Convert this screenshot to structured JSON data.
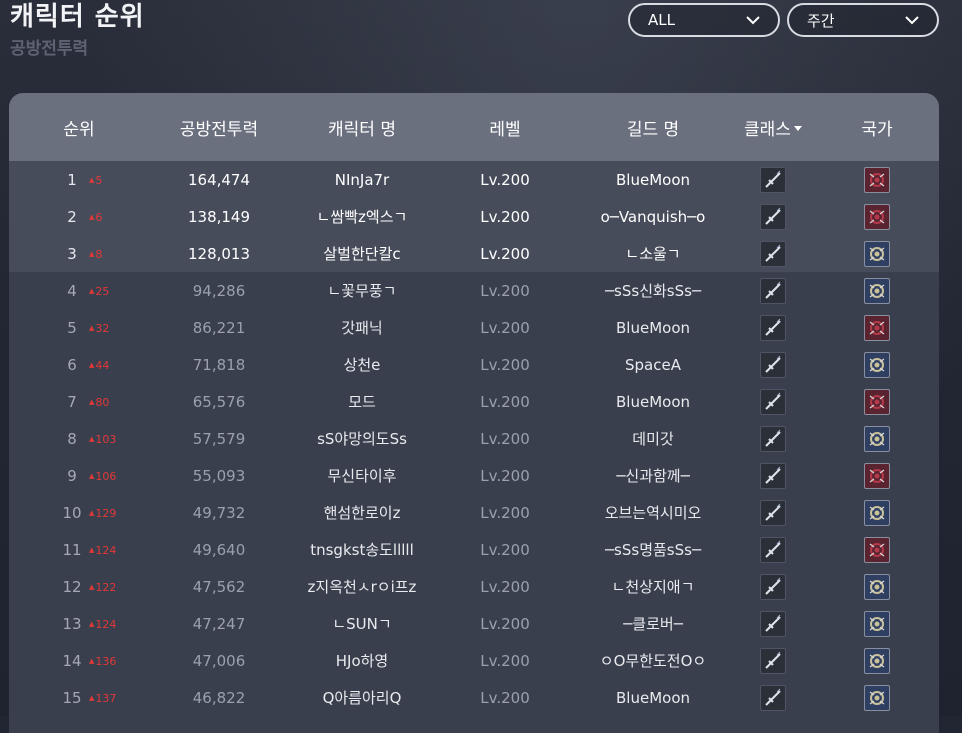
{
  "header": {
    "title": "캐릭터 순위",
    "subtitle": "공방전투력"
  },
  "filters": {
    "region": "ALL",
    "period": "주간"
  },
  "table": {
    "columns": [
      "순위",
      "공방전투력",
      "캐릭터 명",
      "레벨",
      "길드 명",
      "클래스",
      "국가"
    ],
    "rows": [
      {
        "rank": "1",
        "change": "5",
        "power": "164,474",
        "name": "NInJa7r",
        "level": "Lv.200",
        "guild": "BlueMoon",
        "class_icon": "sword-class-icon",
        "nation": "red",
        "nation_icon": "red-nation-emblem-icon"
      },
      {
        "rank": "2",
        "change": "6",
        "power": "138,149",
        "name": "ㄴ쌈빡z엑스ㄱ",
        "level": "Lv.200",
        "guild": "o─Vanquish─o",
        "class_icon": "sword-class-icon",
        "nation": "red",
        "nation_icon": "red-nation-emblem-icon"
      },
      {
        "rank": "3",
        "change": "8",
        "power": "128,013",
        "name": "살벌한단칼c",
        "level": "Lv.200",
        "guild": "ㄴ소울ㄱ",
        "class_icon": "sword-class-icon",
        "nation": "blue",
        "nation_icon": "blue-nation-emblem-icon"
      },
      {
        "rank": "4",
        "change": "25",
        "power": "94,286",
        "name": "ㄴ꽃무풍ㄱ",
        "level": "Lv.200",
        "guild": "─sSs신화sSs─",
        "class_icon": "sword-class-icon",
        "nation": "blue",
        "nation_icon": "blue-nation-emblem-icon"
      },
      {
        "rank": "5",
        "change": "32",
        "power": "86,221",
        "name": "갓패닉",
        "level": "Lv.200",
        "guild": "BlueMoon",
        "class_icon": "sword-class-icon",
        "nation": "red",
        "nation_icon": "red-nation-emblem-icon"
      },
      {
        "rank": "6",
        "change": "44",
        "power": "71,818",
        "name": "상천e",
        "level": "Lv.200",
        "guild": "SpaceA",
        "class_icon": "sword-class-icon",
        "nation": "blue",
        "nation_icon": "blue-nation-emblem-icon"
      },
      {
        "rank": "7",
        "change": "80",
        "power": "65,576",
        "name": "모드",
        "level": "Lv.200",
        "guild": "BlueMoon",
        "class_icon": "sword-class-icon",
        "nation": "red",
        "nation_icon": "red-nation-emblem-icon"
      },
      {
        "rank": "8",
        "change": "103",
        "power": "57,579",
        "name": "sS야망의도Ss",
        "level": "Lv.200",
        "guild": "데미갓",
        "class_icon": "sword-class-icon",
        "nation": "blue",
        "nation_icon": "blue-nation-emblem-icon"
      },
      {
        "rank": "9",
        "change": "106",
        "power": "55,093",
        "name": "무신타이후",
        "level": "Lv.200",
        "guild": "─신과함께─",
        "class_icon": "sword-class-icon",
        "nation": "red",
        "nation_icon": "red-nation-emblem-icon"
      },
      {
        "rank": "10",
        "change": "129",
        "power": "49,732",
        "name": "핸섬한로이z",
        "level": "Lv.200",
        "guild": "오브는역시미오",
        "class_icon": "sword-class-icon",
        "nation": "blue",
        "nation_icon": "blue-nation-emblem-icon"
      },
      {
        "rank": "11",
        "change": "124",
        "power": "49,640",
        "name": "tnsgkst송도lllll",
        "level": "Lv.200",
        "guild": "─sSs명품sSs─",
        "class_icon": "sword-class-icon",
        "nation": "red",
        "nation_icon": "red-nation-emblem-icon"
      },
      {
        "rank": "12",
        "change": "122",
        "power": "47,562",
        "name": "z지옥천ㅅrㅇi프z",
        "level": "Lv.200",
        "guild": "ㄴ천상지애ㄱ",
        "class_icon": "sword-class-icon",
        "nation": "blue",
        "nation_icon": "blue-nation-emblem-icon"
      },
      {
        "rank": "13",
        "change": "124",
        "power": "47,247",
        "name": "ㄴSUNㄱ",
        "level": "Lv.200",
        "guild": "─클로버─",
        "class_icon": "sword-class-icon",
        "nation": "blue",
        "nation_icon": "blue-nation-emblem-icon"
      },
      {
        "rank": "14",
        "change": "136",
        "power": "47,006",
        "name": "HJo하영",
        "level": "Lv.200",
        "guild": "ㅇO무한도전Oㅇ",
        "class_icon": "sword-class-icon",
        "nation": "blue",
        "nation_icon": "blue-nation-emblem-icon"
      },
      {
        "rank": "15",
        "change": "137",
        "power": "46,822",
        "name": "Q아름아리Q",
        "level": "Lv.200",
        "guild": "BlueMoon",
        "class_icon": "sword-class-icon",
        "nation": "blue",
        "nation_icon": "blue-nation-emblem-icon"
      }
    ]
  }
}
